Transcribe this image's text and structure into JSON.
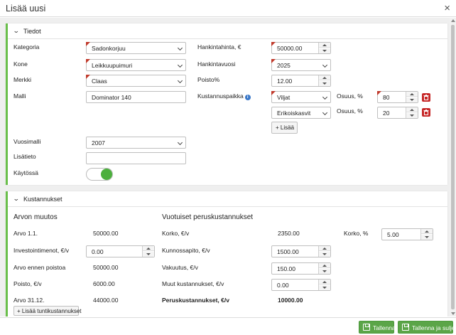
{
  "window": {
    "title": "Lisää uusi",
    "close_glyph": "×"
  },
  "tiedot": {
    "header": "Tiedot",
    "kategoria": {
      "label": "Kategoria",
      "value": "Sadonkorjuu"
    },
    "kone": {
      "label": "Kone",
      "value": "Leikkuupuimuri"
    },
    "merkki": {
      "label": "Merkki",
      "value": "Claas"
    },
    "malli": {
      "label": "Malli",
      "value": "Dominator 140"
    },
    "hankintahinta": {
      "label": "Hankintahinta, €",
      "value": "50000.00"
    },
    "hankintavuosi": {
      "label": "Hankintavuosi",
      "value": "2025"
    },
    "poisto": {
      "label": "Poisto%",
      "value": "12.00"
    },
    "kustannuspaikka": {
      "label": "Kustannuspaikka",
      "info_icon": "i",
      "rows": [
        {
          "value": "Viljat",
          "osuus_label": "Osuus, %",
          "osuus": "80"
        },
        {
          "value": "Erikoiskasvit",
          "osuus_label": "Osuus, %",
          "osuus": "20"
        }
      ],
      "add_label": "+ Lisää"
    },
    "vuosimalli": {
      "label": "Vuosimalli",
      "value": "2007"
    },
    "lisatieto": {
      "label": "Lisätieto",
      "value": ""
    },
    "kaytossa": {
      "label": "Käytössä",
      "on": true
    }
  },
  "kustannukset": {
    "header": "Kustannukset",
    "arvon_muutos": {
      "title": "Arvon muutos",
      "arvo_11": {
        "label": "Arvo 1.1.",
        "value": "50000.00"
      },
      "investointimenot": {
        "label": "Investointimenot, €/v",
        "value": "0.00"
      },
      "arvo_ennen": {
        "label": "Arvo ennen poistoa",
        "value": "50000.00"
      },
      "poisto": {
        "label": "Poisto, €/v",
        "value": "6000.00"
      },
      "arvo_3112": {
        "label": "Arvo 31.12.",
        "value": "44000.00"
      }
    },
    "vuotuiset": {
      "title": "Vuotuiset peruskustannukset",
      "korko": {
        "label": "Korko, €/v",
        "value": "2350.00"
      },
      "korko_pct": {
        "label": "Korko, %",
        "value": "5.00"
      },
      "kunnossapito": {
        "label": "Kunnossapito, €/v",
        "value": "1500.00"
      },
      "vakuutus": {
        "label": "Vakuutus, €/v",
        "value": "150.00"
      },
      "muut": {
        "label": "Muut kustannukset, €/v",
        "value": "0.00"
      },
      "perus": {
        "label": "Peruskustannukset, €/v",
        "value": "10000.00"
      }
    },
    "add_hourly_label": "+ Lisää tuntikustannukset"
  },
  "footer": {
    "save_label": "Tallenna",
    "save_close_label": "Tallenna ja sulje"
  },
  "colors": {
    "accent": "#5ba548",
    "required_marker": "#c0392b",
    "delete": "#c62828"
  }
}
